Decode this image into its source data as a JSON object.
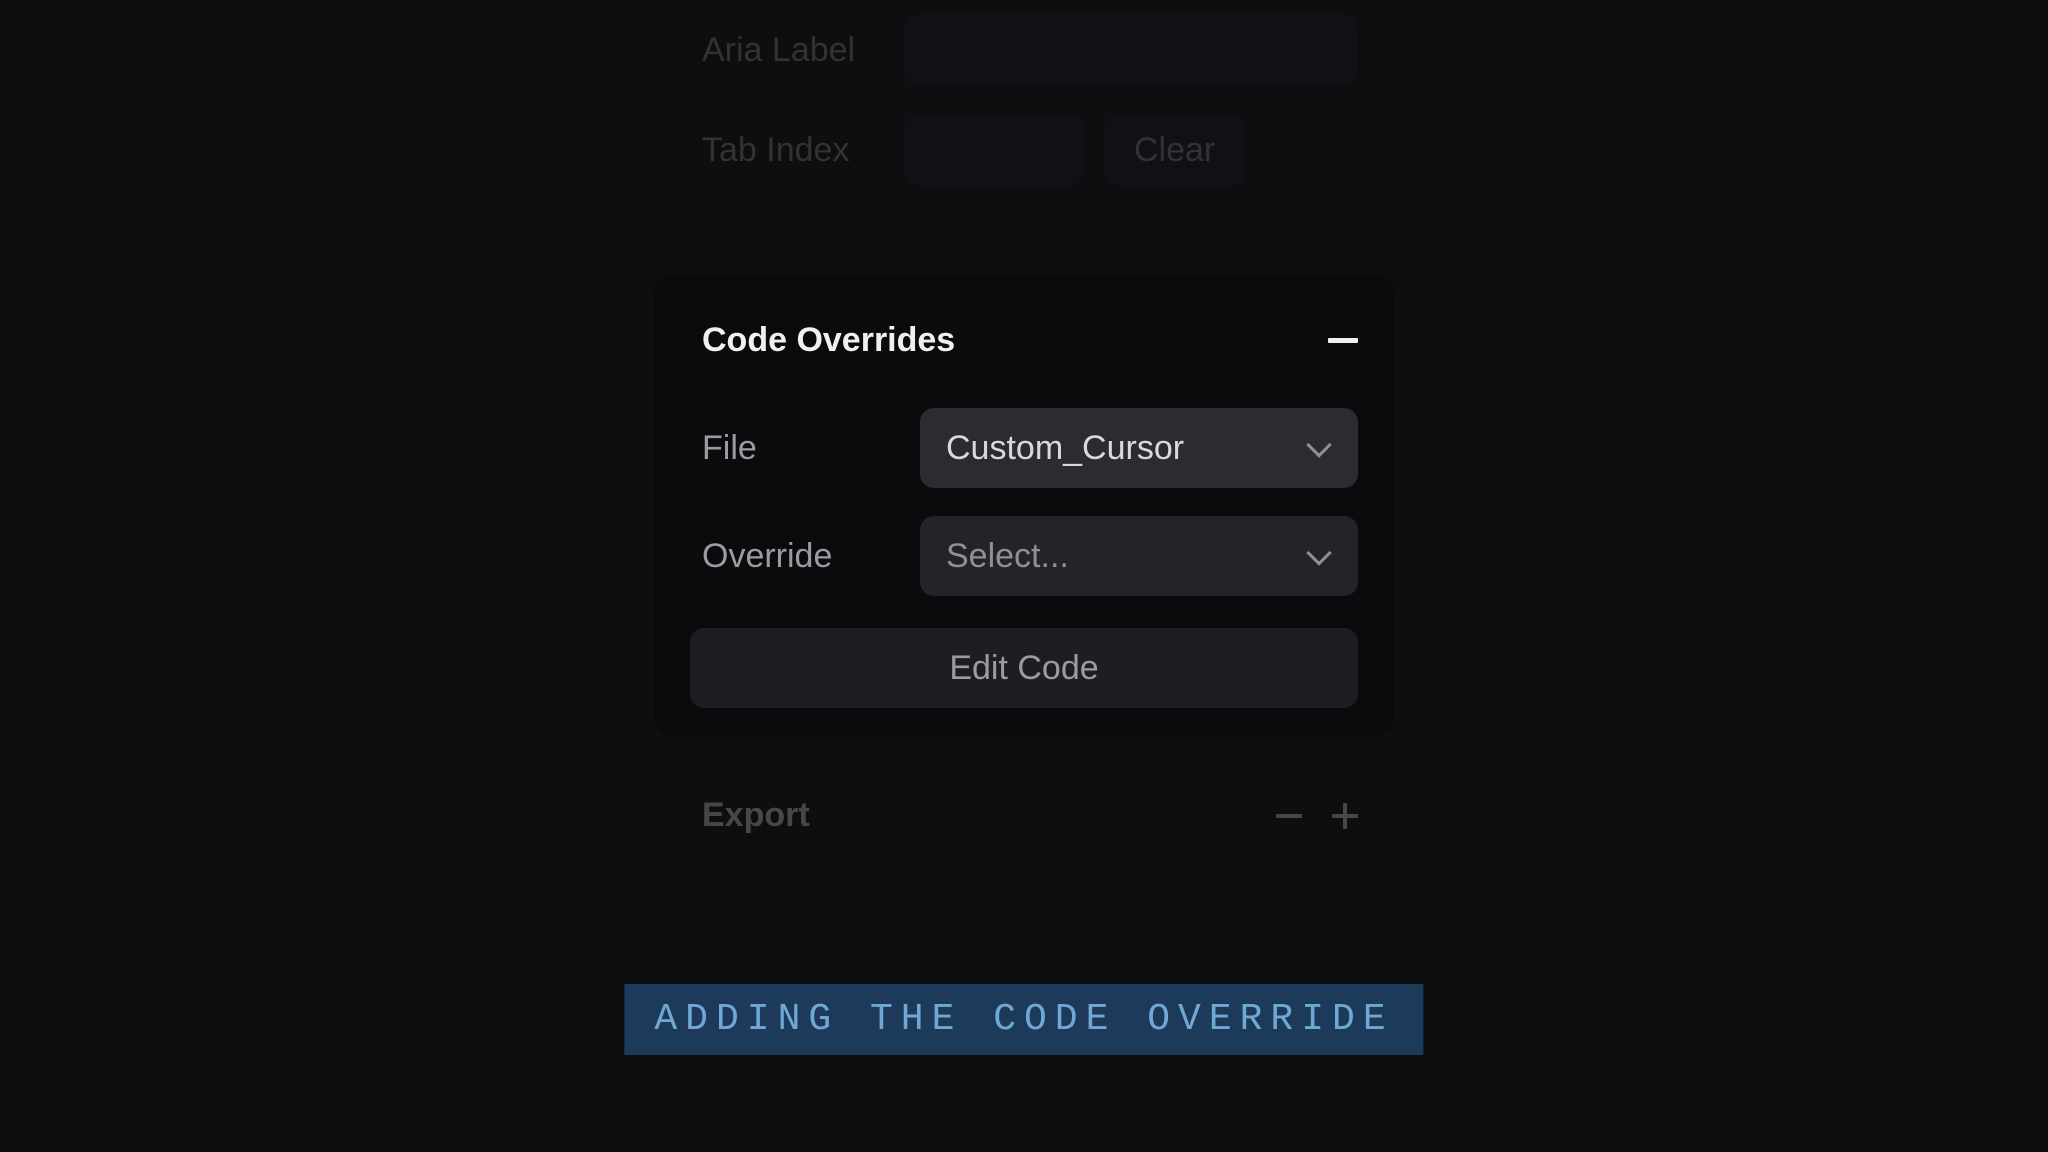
{
  "accessibility": {
    "aria_label_label": "Aria Label",
    "tab_index_label": "Tab Index",
    "clear_label": "Clear"
  },
  "code_overrides": {
    "title": "Code Overrides",
    "file_label": "File",
    "file_value": "Custom_Cursor",
    "override_label": "Override",
    "override_value": "Select...",
    "edit_code_label": "Edit Code"
  },
  "export": {
    "title": "Export"
  },
  "caption": "ADDING THE CODE OVERRIDE"
}
